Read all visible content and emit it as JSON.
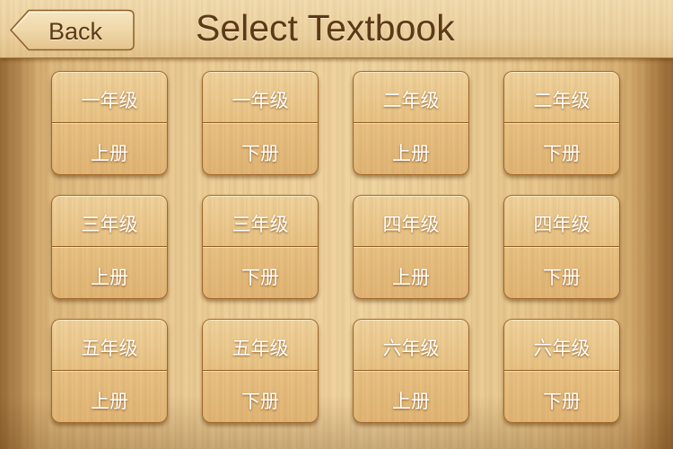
{
  "header": {
    "back_label": "Back",
    "title": "Select Textbook"
  },
  "colors": {
    "title_text": "#5c3a17",
    "card_text": "#ffffff",
    "wood_light": "#eed39f",
    "wood_dark": "#b38246"
  },
  "textbooks": [
    {
      "grade": "一年级",
      "volume": "上册"
    },
    {
      "grade": "一年级",
      "volume": "下册"
    },
    {
      "grade": "二年级",
      "volume": "上册"
    },
    {
      "grade": "二年级",
      "volume": "下册"
    },
    {
      "grade": "三年级",
      "volume": "上册"
    },
    {
      "grade": "三年级",
      "volume": "下册"
    },
    {
      "grade": "四年级",
      "volume": "上册"
    },
    {
      "grade": "四年级",
      "volume": "下册"
    },
    {
      "grade": "五年级",
      "volume": "上册"
    },
    {
      "grade": "五年级",
      "volume": "下册"
    },
    {
      "grade": "六年级",
      "volume": "上册"
    },
    {
      "grade": "六年级",
      "volume": "下册"
    }
  ]
}
